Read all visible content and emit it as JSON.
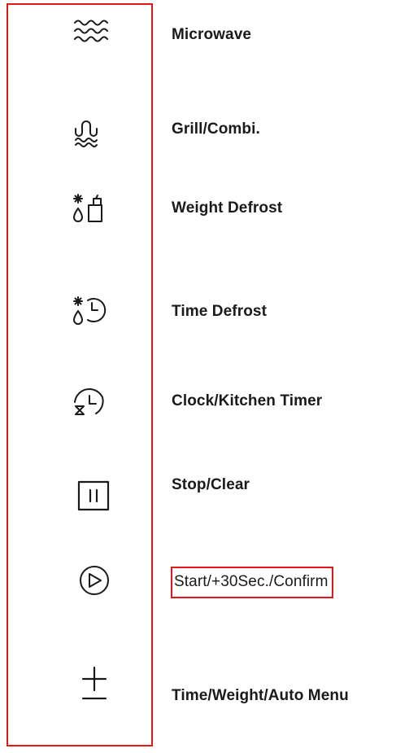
{
  "accent_color": "#e01818",
  "buttons": [
    {
      "label": "Microwave",
      "icon": "microwave-waves-icon"
    },
    {
      "label": "Grill/Combi.",
      "icon": "grill-combi-icon"
    },
    {
      "label": "Weight Defrost",
      "icon": "weight-defrost-icon"
    },
    {
      "label": "Time Defrost",
      "icon": "time-defrost-icon"
    },
    {
      "label": "Clock/Kitchen Timer",
      "icon": "clock-kitchen-timer-icon"
    },
    {
      "label": "Stop/Clear",
      "icon": "stop-clear-icon"
    },
    {
      "label": "Start/+30Sec./Confirm",
      "icon": "start-play-icon"
    },
    {
      "label": "Time/Weight/Auto Menu",
      "icon": "plus-minus-icon"
    }
  ]
}
